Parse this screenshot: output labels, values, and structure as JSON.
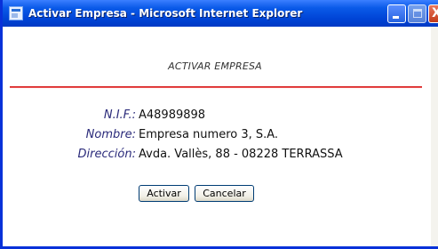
{
  "window": {
    "title": "Activar Empresa - Microsoft Internet Explorer",
    "close_glyph": "X"
  },
  "page": {
    "heading": "ACTIVAR EMPRESA",
    "fields": [
      {
        "label": "N.I.F.:",
        "value": "A48989898"
      },
      {
        "label": "Nombre:",
        "value": "Empresa numero 3, S.A."
      },
      {
        "label": "Dirección:",
        "value": "Avda. Vallès, 88 - 08228 TERRASSA"
      }
    ],
    "buttons": {
      "activar": "Activar",
      "cancelar": "Cancelar"
    }
  },
  "colors": {
    "titlebar": "#0044d6",
    "divider": "#d51818",
    "label_text": "#2a2a7a"
  }
}
